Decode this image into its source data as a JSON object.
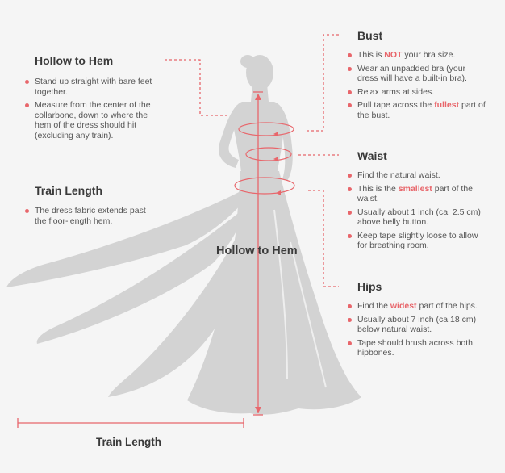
{
  "hollow_to_hem": {
    "title": "Hollow to Hem",
    "bullets": [
      "Stand up straight with bare feet together.",
      "Measure from the center of the collarbone, down to where the hem of the dress should hit (excluding any train)."
    ]
  },
  "train_length": {
    "title": "Train Length",
    "bullets": [
      "The dress fabric extends past the floor-length hem."
    ]
  },
  "bust": {
    "title": "Bust",
    "b1_pre": "This is ",
    "b1_hl": "NOT",
    "b1_post": " your bra size.",
    "b2": "Wear an unpadded bra (your dress will have a built-in bra).",
    "b3": "Relax arms at sides.",
    "b4_pre": "Pull tape across the ",
    "b4_hl": "fullest",
    "b4_post": " part of the bust."
  },
  "waist": {
    "title": "Waist",
    "b1": "Find the natural waist.",
    "b2_pre": "This is the ",
    "b2_hl": "smallest",
    "b2_post": " part of the waist.",
    "b3": "Usually about 1 inch (ca. 2.5 cm) above belly button.",
    "b4": "Keep tape slightly loose to allow for breathing room."
  },
  "hips": {
    "title": "Hips",
    "b1_pre": "Find the ",
    "b1_hl": "widest",
    "b1_post": " part of the hips.",
    "b2": "Usually about 7 inch (ca.18 cm) below natural waist.",
    "b3": "Tape should brush across both hipbones."
  },
  "figure": {
    "center_label": "Hollow to Hem",
    "bottom_label": "Train Length"
  },
  "colors": {
    "accent": "#e8666b",
    "dress": "#d3d3d3",
    "background": "#f5f5f5"
  }
}
